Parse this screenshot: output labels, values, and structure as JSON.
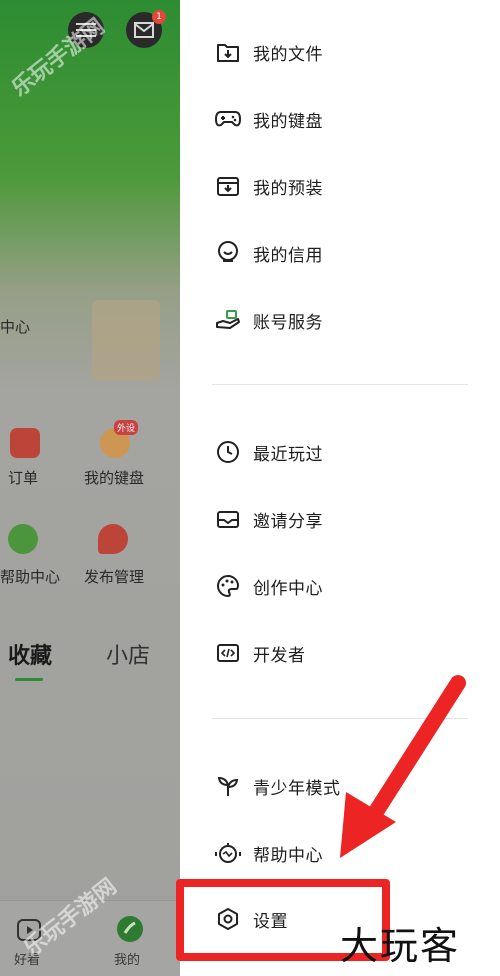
{
  "background_app": {
    "help_center_fragment": "中心",
    "grid": [
      {
        "label": "订单"
      },
      {
        "label": "我的键盘",
        "tag": "外设"
      },
      {
        "label": "帮助中心"
      },
      {
        "label": "发布管理"
      }
    ],
    "tabs": [
      {
        "label": "收藏",
        "active": true
      },
      {
        "label": "小店",
        "active": false
      }
    ],
    "bottom_nav": [
      {
        "label": "好看",
        "icon": "play-icon"
      },
      {
        "label": "我的",
        "icon": "profile-icon"
      }
    ],
    "mail_badge": "1"
  },
  "drawer": {
    "group1": [
      {
        "label": "我的文件",
        "icon": "folder-download-icon"
      },
      {
        "label": "我的键盘",
        "icon": "gamepad-icon"
      },
      {
        "label": "我的预装",
        "icon": "inbox-download-icon"
      },
      {
        "label": "我的信用",
        "icon": "smile-badge-icon"
      },
      {
        "label": "账号服务",
        "icon": "hand-service-icon"
      }
    ],
    "group2": [
      {
        "label": "最近玩过",
        "icon": "clock-icon"
      },
      {
        "label": "邀请分享",
        "icon": "envelope-icon"
      },
      {
        "label": "创作中心",
        "icon": "palette-icon"
      },
      {
        "label": "开发者",
        "icon": "code-icon"
      }
    ],
    "group3": [
      {
        "label": "青少年模式",
        "icon": "sprout-icon"
      },
      {
        "label": "帮助中心",
        "icon": "robot-help-icon"
      },
      {
        "label": "设置",
        "icon": "settings-hexagon-icon"
      }
    ]
  },
  "watermark": "乐玩手游网",
  "brand_stamp": "大玩客",
  "colors": {
    "accent_green": "#2e8f33",
    "highlight_red": "#ec2424"
  }
}
